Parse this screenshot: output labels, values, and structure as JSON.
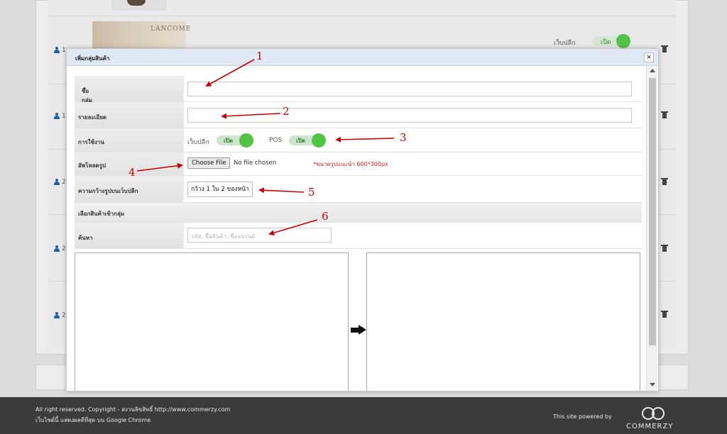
{
  "background": {
    "brand_text": "LANCOME",
    "row_numbers": [
      "1",
      "1",
      "2",
      "2",
      "2"
    ],
    "web_label": "เว็บปลีก",
    "toggle_label": "เปิด"
  },
  "modal": {
    "title": "เพิ่มกลุ่มสินค้า",
    "close_label": "×",
    "fields": {
      "name_label": "ชื่อกลุ่มสินค้า",
      "required_mark": "*",
      "name_value": "",
      "detail_label": "รายละเอียด",
      "detail_value": "",
      "usage_label": "การใช้งาน",
      "web_label": "เว็บปลีก",
      "web_toggle": "เปิด",
      "pos_label": "POS",
      "pos_toggle": "เปิด",
      "upload_label": "อัพโหลดรูป",
      "choose_file": "Choose File",
      "no_file": "No file chosen",
      "size_hint": "*ขนาดรูปแนะนำ 600*300px",
      "width_label": "ความกว้างรูปบนเว็บปลีก",
      "width_value": "กว้าง 1 ใน 2 ของหน้า",
      "select_section": "เลือกสินค้าเข้ากลุ่ม",
      "search_label": "ค้นหา",
      "search_placeholder": "รหัส, ชื่อสินค้า, ชื่อแบรนด์"
    }
  },
  "annotations": [
    "1",
    "2",
    "3",
    "4",
    "5",
    "6"
  ],
  "footer": {
    "copyright": "All right reserved. Copyright - สงวนลิขสิทธิ์ http://www.commerzy.com",
    "browser_note": "เว็บไซต์นี้ แสดงผลดีที่สุด บน Google Chrome",
    "powered_by": "This site powered by",
    "logo_text": "COMMERZY"
  },
  "colors": {
    "toggle_on": "#52c443",
    "annotation": "#cc0000",
    "hint": "#e02020",
    "footer_bg": "#3b3b3b",
    "modal_header": "#dfe8f3"
  }
}
